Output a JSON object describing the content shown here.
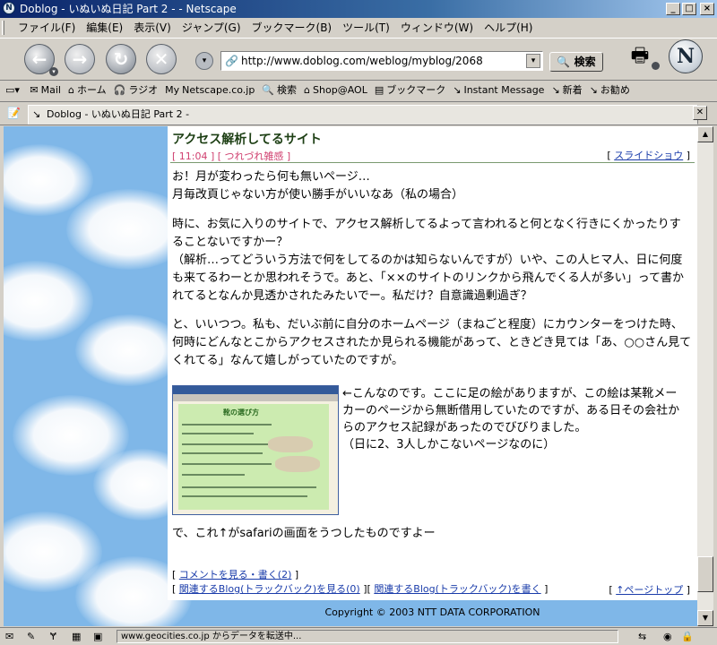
{
  "window": {
    "title": "Doblog - いぬいぬ日記 Part 2 - - Netscape",
    "app_icon": "N"
  },
  "menu": [
    "ファイル(F)",
    "編集(E)",
    "表示(V)",
    "ジャンプ(G)",
    "ブックマーク(B)",
    "ツール(T)",
    "ウィンドウ(W)",
    "ヘルプ(H)"
  ],
  "nav": {
    "url": "http://www.doblog.com/weblog/myblog/2068",
    "search_label": "検索"
  },
  "personal_toolbar": [
    {
      "icon": "mail-icon",
      "glyph": "✉",
      "label": "Mail"
    },
    {
      "icon": "home-icon",
      "glyph": "⌂",
      "label": "ホーム"
    },
    {
      "icon": "radio-icon",
      "glyph": "🎧",
      "label": "ラジオ"
    },
    {
      "icon": "my-icon",
      "glyph": "My",
      "label": "Netscape.co.jp"
    },
    {
      "icon": "search-icon",
      "glyph": "🔍",
      "label": "検索"
    },
    {
      "icon": "aol-icon",
      "glyph": "⌂",
      "label": "Shop@AOL"
    },
    {
      "icon": "bookmark-icon",
      "glyph": "▤",
      "label": "ブックマーク"
    },
    {
      "icon": "link-icon",
      "glyph": "↘",
      "label": "Instant Message"
    },
    {
      "icon": "link-icon",
      "glyph": "↘",
      "label": "新着"
    },
    {
      "icon": "link-icon",
      "glyph": "↘",
      "label": "お勧め"
    }
  ],
  "tab": {
    "label": "Doblog - いぬいぬ日記 Part 2 -"
  },
  "article": {
    "title": "アクセス解析してるサイト",
    "meta": "[ 11:04 ] [ つれづれ雑感 ]",
    "slideshow": "スライドショウ",
    "p1": "お！月が変わったら何も無いページ…\n月毎改頁じゃない方が使い勝手がいいなあ（私の場合）",
    "p2": "時に、お気に入りのサイトで、アクセス解析してるよって言われると何となく行きにくかったりすることないですかー？\n（解析…ってどういう方法で何をしてるのかは知らないんですが）いや、この人ヒマ人、日に何度も来てるわーとか思われそうで。あと、「××のサイトのリンクから飛んでくる人が多い」って書かれてるとなんか見透かされたみたいでー。私だけ？自意識過剰過ぎ？",
    "p3": "と、いいつつ。私も、だいぶ前に自分のホームページ（まねごと程度）にカウンターをつけた時、何時にどんなとこからアクセスされたか見られる機能があって、ときどき見ては「あ、○○さん見てくれてる」なんて嬉しがっていたのですが。",
    "thumb_title": "靴の選び方",
    "side": "←こんなのです。ここに足の絵がありますが、この絵は某靴メーカーのページから無断借用していたのですが、ある日その会社からのアクセス記録があったのでびびりました。\n（日に2、3人しかこないページなのに）",
    "p4": "で、これ↑がsafariの画面をうつしたものですよー",
    "comments": "コメントを見る・書く(2)",
    "trackback_view": "関連するBlog(トラックバック)を見る(0)",
    "trackback_write": "関連するBlog(トラックバック)を書く",
    "pagetop": "↑ページトップ"
  },
  "copyright": "Copyright © 2003 NTT DATA CORPORATION",
  "status": {
    "text": "www.geocities.co.jp からデータを転送中..."
  },
  "colors": {
    "title_accent": "#1d3f14",
    "meta": "#d04070",
    "link": "#1a3caa",
    "sky": "#7fb7e8"
  }
}
